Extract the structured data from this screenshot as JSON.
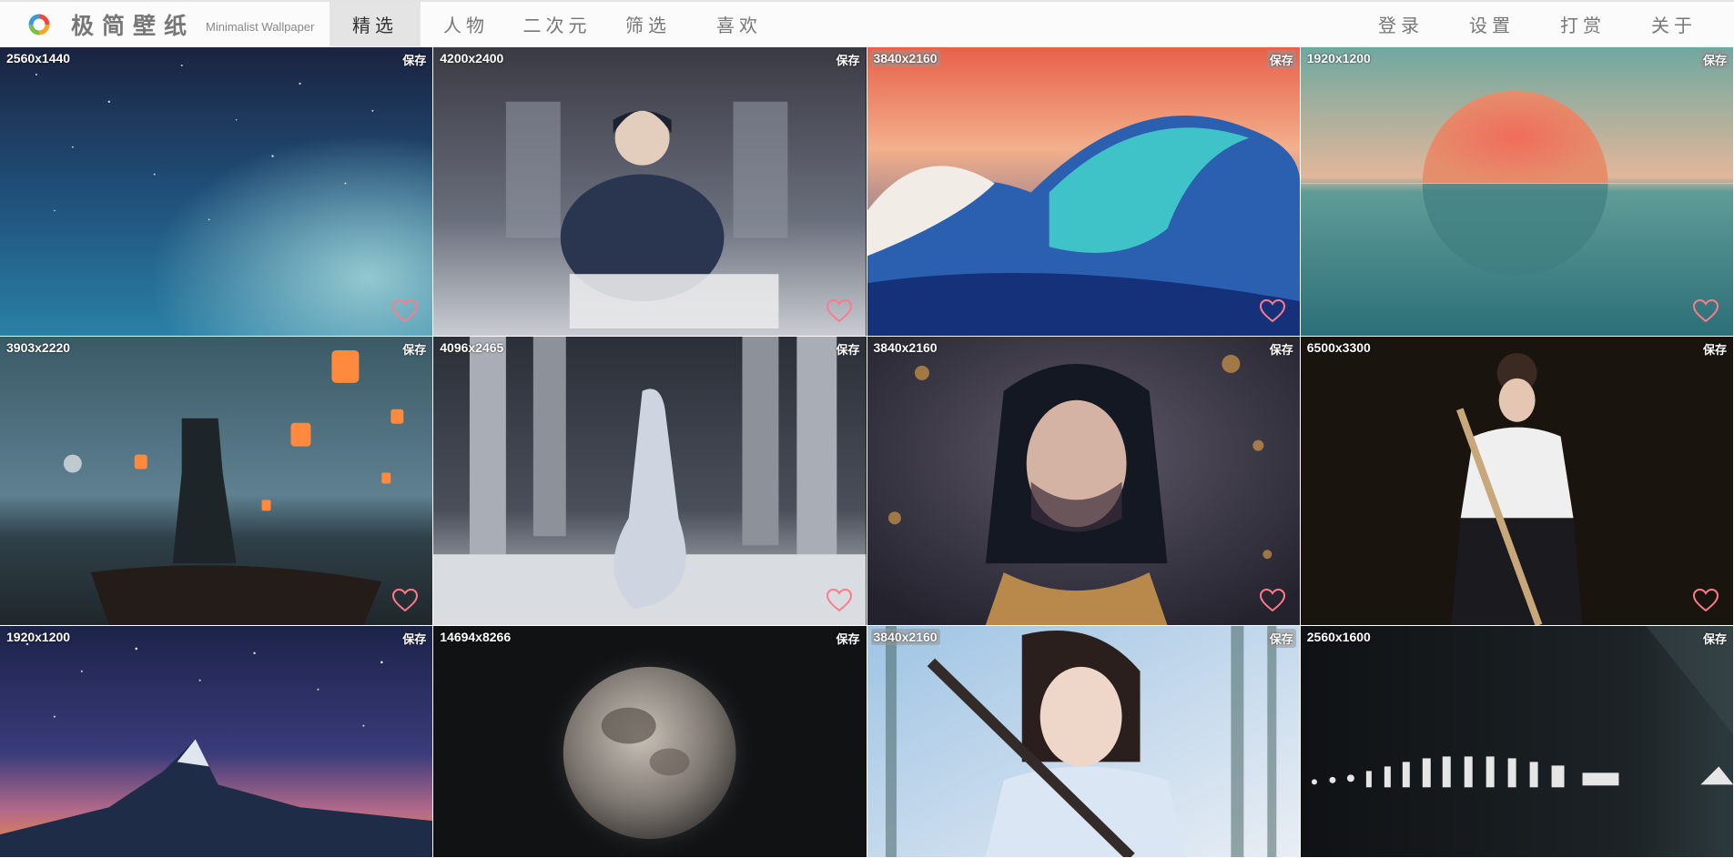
{
  "app": {
    "title": "极简壁纸",
    "subtitle": "Minimalist Wallpaper"
  },
  "nav": {
    "left": [
      {
        "label": "精选",
        "active": true
      },
      {
        "label": "人物",
        "active": false
      },
      {
        "label": "二次元",
        "active": false
      },
      {
        "label": "筛选",
        "active": false
      },
      {
        "label": "喜欢",
        "active": false
      }
    ],
    "right": [
      {
        "label": "登录"
      },
      {
        "label": "设置"
      },
      {
        "label": "打赏"
      },
      {
        "label": "关于"
      }
    ]
  },
  "wallpapers": [
    {
      "resolution": "2560x1440",
      "save": "保存",
      "icon": "heart-icon"
    },
    {
      "resolution": "4200x2400",
      "save": "保存",
      "icon": "heart-icon"
    },
    {
      "resolution": "3840x2160",
      "save": "保存",
      "icon": "heart-icon"
    },
    {
      "resolution": "1920x1200",
      "save": "保存",
      "icon": "heart-icon"
    },
    {
      "resolution": "3903x2220",
      "save": "保存",
      "icon": "heart-icon"
    },
    {
      "resolution": "4096x2465",
      "save": "保存",
      "icon": "heart-icon"
    },
    {
      "resolution": "3840x2160",
      "save": "保存",
      "icon": "heart-icon"
    },
    {
      "resolution": "6500x3300",
      "save": "保存",
      "icon": "heart-icon"
    },
    {
      "resolution": "1920x1200",
      "save": "保存",
      "icon": "heart-icon"
    },
    {
      "resolution": "14694x8266",
      "save": "保存",
      "icon": "heart-icon"
    },
    {
      "resolution": "3840x2160",
      "save": "保存",
      "icon": "heart-icon"
    },
    {
      "resolution": "2560x1600",
      "save": "保存",
      "icon": "heart-icon"
    }
  ],
  "colors": {
    "heart": "#ff7a8a",
    "nav_active_bg": "#e4e4e4",
    "nav_text": "#777777"
  }
}
